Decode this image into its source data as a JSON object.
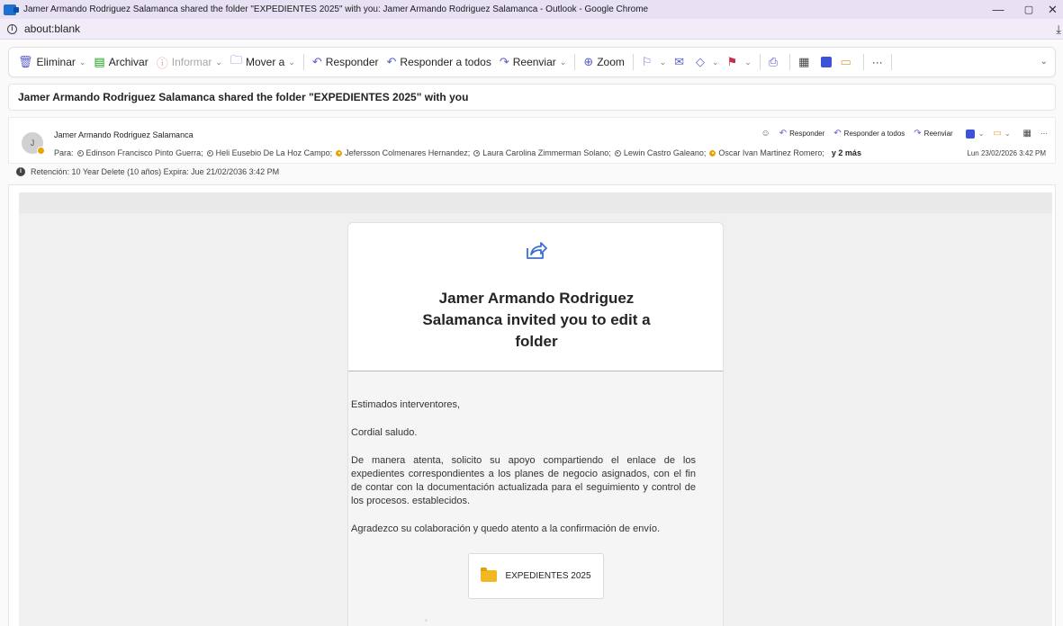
{
  "window": {
    "title": "Jamer Armando Rodriguez Salamanca shared the folder \"EXPEDIENTES 2025\" with you: Jamer Armando Rodriguez Salamanca - Outlook - Google Chrome",
    "minimize": "—",
    "restore": "▢",
    "close": "✕"
  },
  "address": {
    "url": "about:blank"
  },
  "ribbon": {
    "delete": "Eliminar",
    "archive": "Archivar",
    "report": "Informar",
    "move": "Mover a",
    "reply": "Responder",
    "reply_all": "Responder a todos",
    "forward": "Reenviar",
    "zoom": "Zoom",
    "more": "···"
  },
  "subject": "Jamer Armando Rodriguez Salamanca shared the folder \"EXPEDIENTES 2025\" with you",
  "sender": {
    "initial": "J",
    "name": "Jamer Armando Rodriguez Salamanca",
    "to_label": "Para:",
    "recipients": [
      "Edinson Francisco Pinto Guerra;",
      "Heli Eusebio De La Hoz Campo;",
      "Jefersson Colmenares Hernandez;",
      "Laura Carolina Zimmerman Solano;",
      "Lewin Castro Galeano;",
      "Oscar Ivan Martinez Romero;"
    ],
    "more": "y 2 más",
    "timestamp": "Lun 23/02/2026 3:42 PM",
    "actions": {
      "reply": "Responder",
      "reply_all": "Responder a todos",
      "forward": "Reenviar",
      "more": "···"
    }
  },
  "retention": "Retención: 10 Year Delete (10 años) Expira: Jue 21/02/2036 3:42 PM",
  "message": {
    "invite_title": "Jamer Armando Rodriguez Salamanca invited you to edit a folder",
    "greeting": "Estimados interventores,",
    "salute": "Cordial saludo.",
    "paragraph": "De manera atenta, solicito su apoyo compartiendo el enlace de los expedientes correspondientes a los planes de negocio asignados, con el fin de contar con la documentación actualizada para el seguimiento y control de los procesos. establecidos.",
    "thanks": "Agradezco su colaboración y quedo atento a la confirmación de envío.",
    "folder_name": "EXPEDIENTES 2025"
  },
  "colors": {
    "accent": "#5b5fc7",
    "flag": "#c4314b",
    "presence_away": "#eaa300",
    "folder": "#f2b822"
  }
}
